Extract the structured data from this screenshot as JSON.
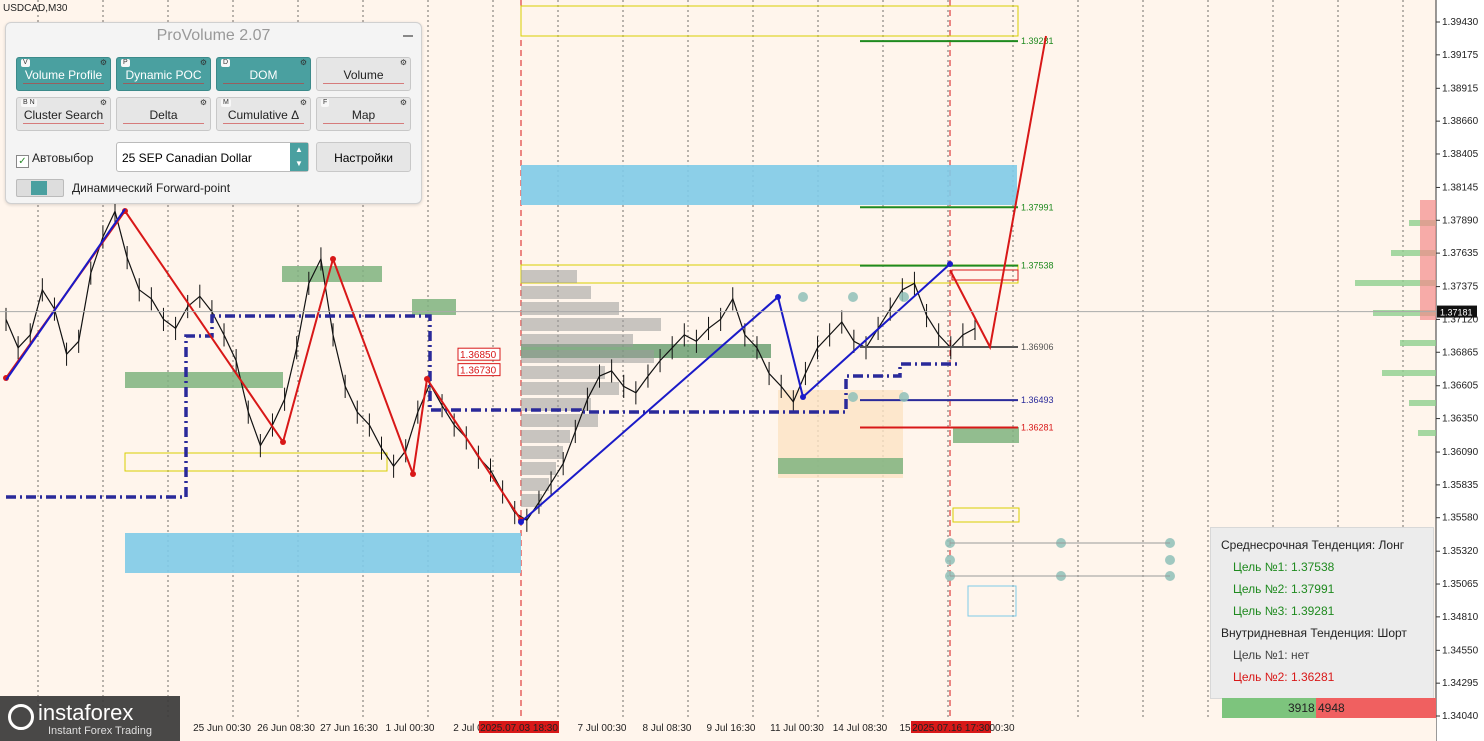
{
  "symbol": "USDCAD,M30",
  "colors": {
    "bg": "#fff5ec",
    "blue": "#1a1ac8",
    "red": "#d81818",
    "navy": "#2a2a9a",
    "green": "#1f8a1f",
    "cyan": "#7fcbe8",
    "greenzone": "#7fb37f"
  },
  "provolume": {
    "title": "ProVolume 2.07",
    "buttons": [
      {
        "key": "V",
        "label": "Volume Profile",
        "state": "on"
      },
      {
        "key": "P",
        "label": "Dynamic POC",
        "state": "on"
      },
      {
        "key": "D",
        "label": "DOM",
        "state": "on"
      },
      {
        "key": "",
        "label": "Volume",
        "state": "off"
      },
      {
        "key": "B N",
        "label": "Cluster Search",
        "state": "off"
      },
      {
        "key": "",
        "label": "Delta",
        "state": "off"
      },
      {
        "key": "M",
        "label": "Cumulative Δ",
        "state": "off"
      },
      {
        "key": "F",
        "label": "Map",
        "state": "off"
      }
    ],
    "autoselect_label": "Автовыбор",
    "autoselect_checked": true,
    "instrument": "25 SEP Canadian Dollar",
    "settings_label": "Настройки",
    "forward_label": "Динамический Forward-point"
  },
  "trend_box": {
    "mid_title": "Среднесрочная Тенденция: Лонг",
    "mid_targets": [
      "Цель №1: 1.37538",
      "Цель №2: 1.37991",
      "Цель №3: 1.39281"
    ],
    "intra_title": "Внутридневная Тенденция: Шорт",
    "intra_targets": [
      "Цель №1: нет",
      "Цель №2: 1.36281"
    ],
    "vol_green": "3918",
    "vol_red": "4948"
  },
  "logo": {
    "name": "instaforex",
    "sub": "Instant Forex Trading"
  },
  "chart_data": {
    "type": "line",
    "title": "USDCAD,M30",
    "y_axis_ticks": [
      "1.39430",
      "1.39175",
      "1.38915",
      "1.38660",
      "1.38405",
      "1.38145",
      "1.37890",
      "1.37635",
      "1.37375",
      "1.37120",
      "1.36865",
      "1.36605",
      "1.36350",
      "1.36090",
      "1.35835",
      "1.35580",
      "1.35320",
      "1.35065",
      "1.34810",
      "1.34550",
      "1.34295",
      "1.34040"
    ],
    "ylim": [
      1.3404,
      1.3943
    ],
    "current_price": "1.37181",
    "x_date_labels": [
      "25 Jun 00:30",
      "26 Jun 08:30",
      "27 Jun 16:30",
      "1 Jul 00:30",
      "2 Jul 0",
      "2025.07.03 18:30",
      "7 Jul 00:30",
      "8 Jul 08:30",
      "9 Jul 16:30",
      "11 Jul 00:30",
      "14 Jul 08:30",
      "15",
      "2025.07.16 17:30",
      "00:30"
    ],
    "levels": [
      {
        "label": "1.39281",
        "value": 1.39281,
        "color": "#1f8a1f"
      },
      {
        "label": "1.37991",
        "value": 1.37991,
        "color": "#1f8a1f"
      },
      {
        "label": "1.37538",
        "value": 1.37538,
        "color": "#1f8a1f"
      },
      {
        "label": "1.36906",
        "value": 1.36906,
        "color": "#555555"
      },
      {
        "label": "1.36493",
        "value": 1.36493,
        "color": "#2a2a9a"
      },
      {
        "label": "1.36281",
        "value": 1.36281,
        "color": "#d81818"
      }
    ],
    "box_labels": [
      {
        "label": "1.36850",
        "value": 1.3685
      },
      {
        "label": "1.36730",
        "value": 1.3673
      }
    ],
    "zigzag_red": [
      {
        "t": 0,
        "p": 1.3796
      },
      {
        "t": 1,
        "p": 1.3612
      },
      {
        "t": 2,
        "p": 1.3759
      },
      {
        "t": 3,
        "p": 1.3596
      },
      {
        "t": 4,
        "p": 1.3662
      },
      {
        "t": 5,
        "p": 1.3556
      }
    ],
    "zigzag_blue": [
      {
        "t": 0,
        "p": 1.366
      },
      {
        "t": 1,
        "p": 1.3796
      },
      {
        "t": 5,
        "p": 1.3556
      },
      {
        "t": 6,
        "p": 1.3728
      },
      {
        "t": 7,
        "p": 1.3648
      },
      {
        "t": 8,
        "p": 1.3754
      }
    ],
    "forecast_red": [
      {
        "t": 8,
        "p": 1.3754
      },
      {
        "t": 9,
        "p": 1.369
      },
      {
        "t": 10,
        "p": 1.39281
      }
    ],
    "series": [
      {
        "name": "USDCAD",
        "values": [
          1.3712,
          1.369,
          1.37,
          1.3735,
          1.372,
          1.3685,
          1.3695,
          1.3748,
          1.3776,
          1.3796,
          1.376,
          1.3735,
          1.3728,
          1.3712,
          1.3705,
          1.3722,
          1.373,
          1.3718,
          1.37,
          1.368,
          1.364,
          1.3614,
          1.363,
          1.365,
          1.369,
          1.374,
          1.3759,
          1.37,
          1.366,
          1.364,
          1.363,
          1.3612,
          1.3598,
          1.361,
          1.364,
          1.3662,
          1.3645,
          1.363,
          1.362,
          1.3605,
          1.3595,
          1.3578,
          1.3562,
          1.3556,
          1.357,
          1.3585,
          1.36,
          1.3625,
          1.365,
          1.3668,
          1.3672,
          1.366,
          1.3655,
          1.3668,
          1.368,
          1.369,
          1.37,
          1.3695,
          1.3705,
          1.3712,
          1.3728,
          1.37,
          1.369,
          1.367,
          1.366,
          1.3648,
          1.367,
          1.369,
          1.37,
          1.371,
          1.3695,
          1.369,
          1.3705,
          1.372,
          1.3735,
          1.374,
          1.3715,
          1.37,
          1.369,
          1.37,
          1.3705
        ]
      }
    ]
  }
}
